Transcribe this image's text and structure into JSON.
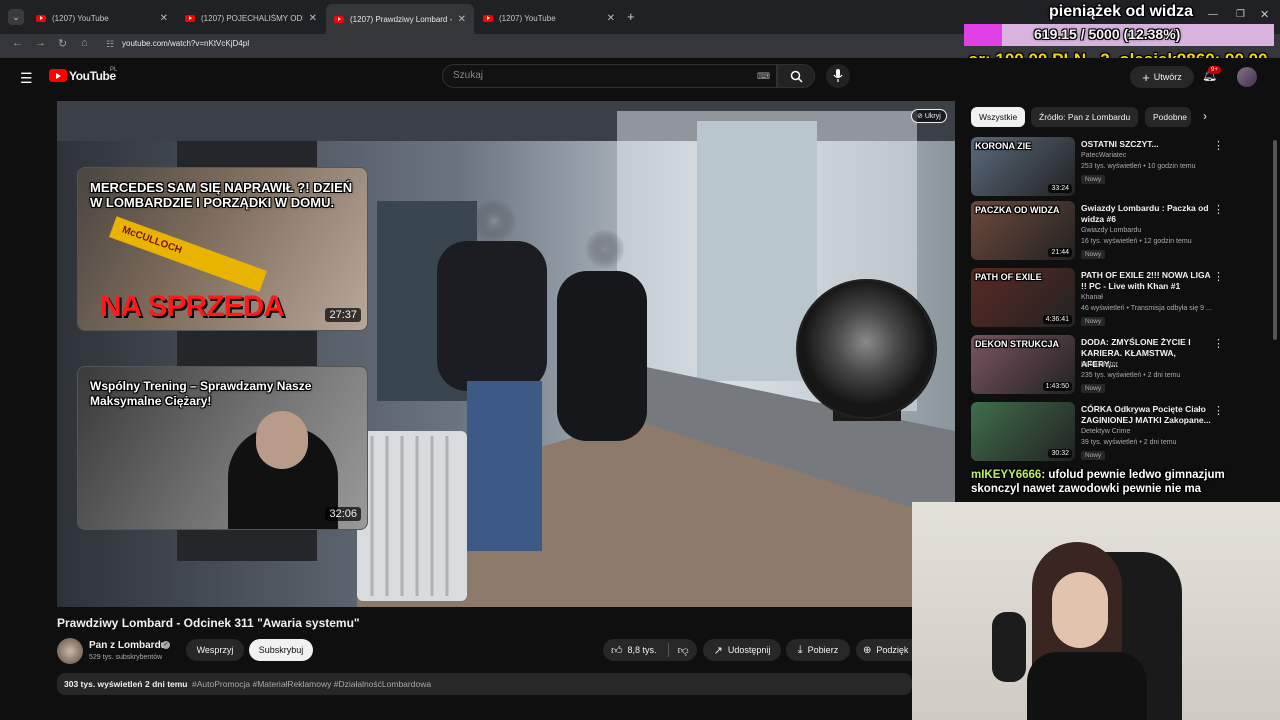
{
  "browser": {
    "tabs": [
      {
        "title": "(1207) YouTube",
        "active": false
      },
      {
        "title": "(1207) POJECHALIŚMY ODMIE",
        "active": false
      },
      {
        "title": "(1207) Prawdziwy Lombard - O",
        "active": true
      },
      {
        "title": "(1207) YouTube",
        "active": false
      }
    ],
    "url": "youtube.com/watch?v=nKtVcKjD4pI"
  },
  "overlay": {
    "donation_title": "pieniążek od widza",
    "donation_progress_text": "619.15 / 5000 (12.38%)",
    "donation_progress": 0.1238,
    "ticker_left": "or: 100.00 PLN",
    "ticker_right": "2. olesiek9860: 90.00",
    "chat_user": "mIKEYY6666",
    "chat_message_1": ": ufolud pewnie ledwo gimnazjum",
    "chat_message_2": "skonczyl nawet zawodowki pewnie nie ma"
  },
  "header": {
    "logo": "YouTube",
    "country": "PL",
    "search_placeholder": "Szukaj",
    "create_label": "Utwórz",
    "notif_count": "9+"
  },
  "video": {
    "hide_label": "Ukryj",
    "endcard_1": {
      "title": "MERCEDES SAM SIĘ NAPRAWIŁ ?! DZIEŃ W LOMBARDZIE I PORZĄDKI W DOMU.",
      "duration": "27:37",
      "overlay_text": "NA SPRZEDA",
      "brand_text": "McCULLOCH"
    },
    "endcard_2": {
      "title": "Wspólny Trening – Sprawdzamy Nasze Maksymalne Ciężary!",
      "duration": "32:06"
    }
  },
  "meta": {
    "title": "Prawdziwy Lombard - Odcinek 311 \"Awaria systemu\"",
    "channel": "Pan z Lombardu",
    "subscribers": "529 tys. subskrybentów",
    "support_label": "Wesprzyj",
    "subscribe_label": "Subskrybuj",
    "likes": "8,8 tys.",
    "share_label": "Udostępnij",
    "download_label": "Pobierz",
    "thanks_label": "Podzięk",
    "views": "303 tys. wyświetleń",
    "age": "2 dni temu",
    "tags": "#AutoPromocja #MateriałReklamowy #DziałalnośćLombardowa"
  },
  "filters": [
    "Wszystkie",
    "Źródło: Pan z Lombardu",
    "Podobne"
  ],
  "recommendations": [
    {
      "title": "OSTATNI SZCZYT...",
      "channel": "PatecWariatec",
      "stats": "253 tys. wyświetleń • 10 godzin temu",
      "badge": "Nowy",
      "duration": "33:24",
      "thumb_text": "KORONA ZIE",
      "color": "#5a6b7d"
    },
    {
      "title": "Gwiazdy Lombardu : Paczka od widza #6",
      "channel": "Gwiazdy Lombardu",
      "stats": "16 tys. wyświetleń • 12 godzin temu",
      "badge": "Nowy",
      "duration": "21:44",
      "thumb_text": "PACZKA OD WIDZA",
      "color": "#6e4a3a"
    },
    {
      "title": "PATH OF EXILE 2!!! NOWA LIGA !! PC - Live with Khan #1",
      "channel": "Khanał",
      "stats": "46 wyświetleń • Transmisja odbyła się 9 ...",
      "badge": "Nowy",
      "duration": "4:36:41",
      "thumb_text": "PATH OF EXILE",
      "color": "#5a2a22"
    },
    {
      "title": "DODA: ZMYŚLONE ŻYCIE I KARIERA. KŁAMSTWA, AFERY,...",
      "channel": "Kuba Wątor",
      "stats": "235 tys. wyświetleń • 2 dni temu",
      "badge": "Nowy",
      "duration": "1:43:50",
      "thumb_text": "DEKON STRUKCJA",
      "color": "#7a5560"
    },
    {
      "title": "CÓRKA Odkrywa Pocięte Ciało ZAGINIONEJ MATKI Zakopane...",
      "channel": "Detektyw Crime",
      "stats": "39 tys. wyświetleń • 2 dni temu",
      "badge": "Nowy",
      "duration": "30:32",
      "thumb_text": "",
      "color": "#3f6e4a"
    }
  ]
}
